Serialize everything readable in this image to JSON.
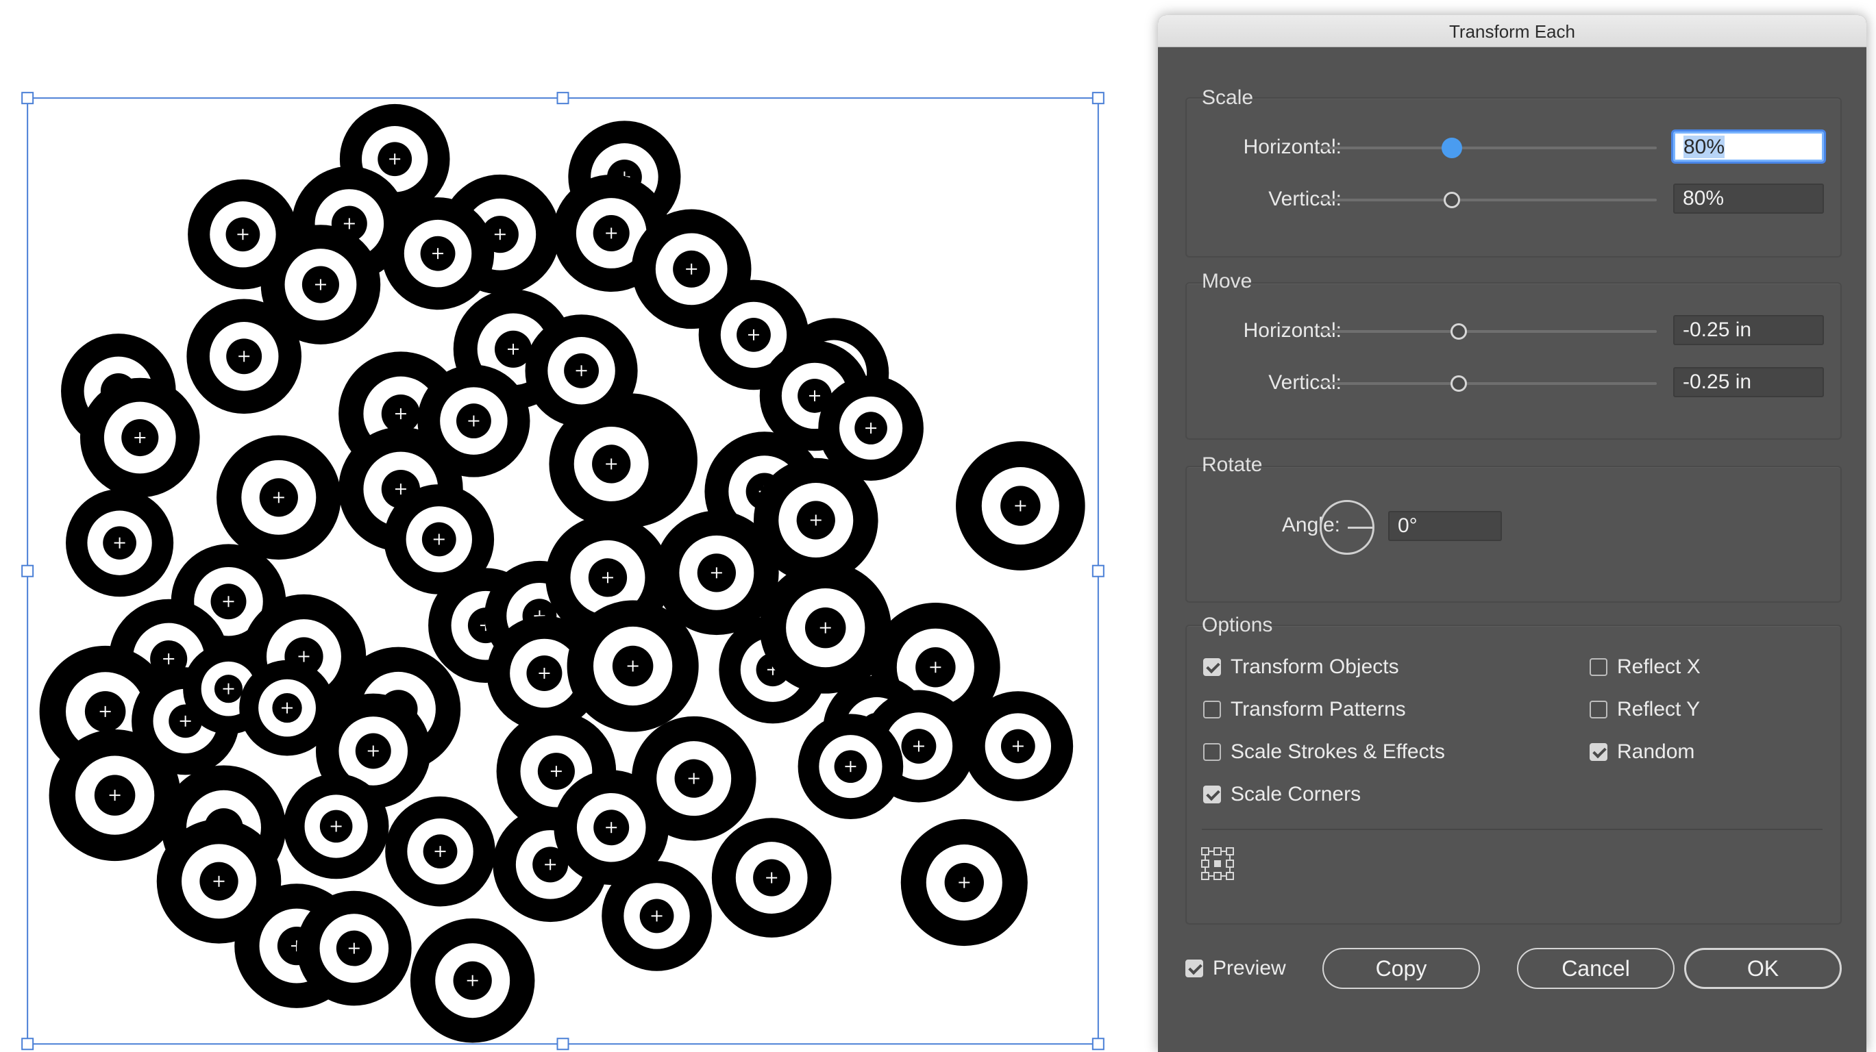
{
  "dialog": {
    "title": "Transform Each",
    "scale": {
      "label": "Scale",
      "horizontal_label": "Horizontal:",
      "horizontal_value": "80%",
      "horizontal_level": 0.39,
      "vertical_label": "Vertical:",
      "vertical_value": "80%",
      "vertical_level": 0.39
    },
    "move": {
      "label": "Move",
      "horizontal_label": "Horizontal:",
      "horizontal_value": "-0.25 in",
      "horizontal_level": 0.41,
      "vertical_label": "Vertical:",
      "vertical_value": "-0.25 in",
      "vertical_level": 0.41
    },
    "rotate": {
      "label": "Rotate",
      "angle_label": "Angle:",
      "angle_value": "0°"
    },
    "options": {
      "label": "Options",
      "transform_objects": {
        "label": "Transform Objects",
        "checked": true
      },
      "transform_patterns": {
        "label": "Transform Patterns",
        "checked": false
      },
      "scale_strokes": {
        "label": "Scale Strokes & Effects",
        "checked": false
      },
      "scale_corners": {
        "label": "Scale Corners",
        "checked": true
      },
      "reflect_x": {
        "label": "Reflect X",
        "checked": false
      },
      "reflect_y": {
        "label": "Reflect Y",
        "checked": false
      },
      "random": {
        "label": "Random",
        "checked": true
      },
      "reference_point_icon": "reference-point-grid-icon"
    },
    "preview": {
      "label": "Preview",
      "checked": true
    },
    "buttons": {
      "copy": "Copy",
      "cancel": "Cancel",
      "ok": "OK"
    }
  },
  "colors": {
    "dialog_bg": "#535353",
    "accent_blue": "#4a9cf0",
    "selection_blue": "#4a7fd6",
    "ring_black": "#000000"
  }
}
